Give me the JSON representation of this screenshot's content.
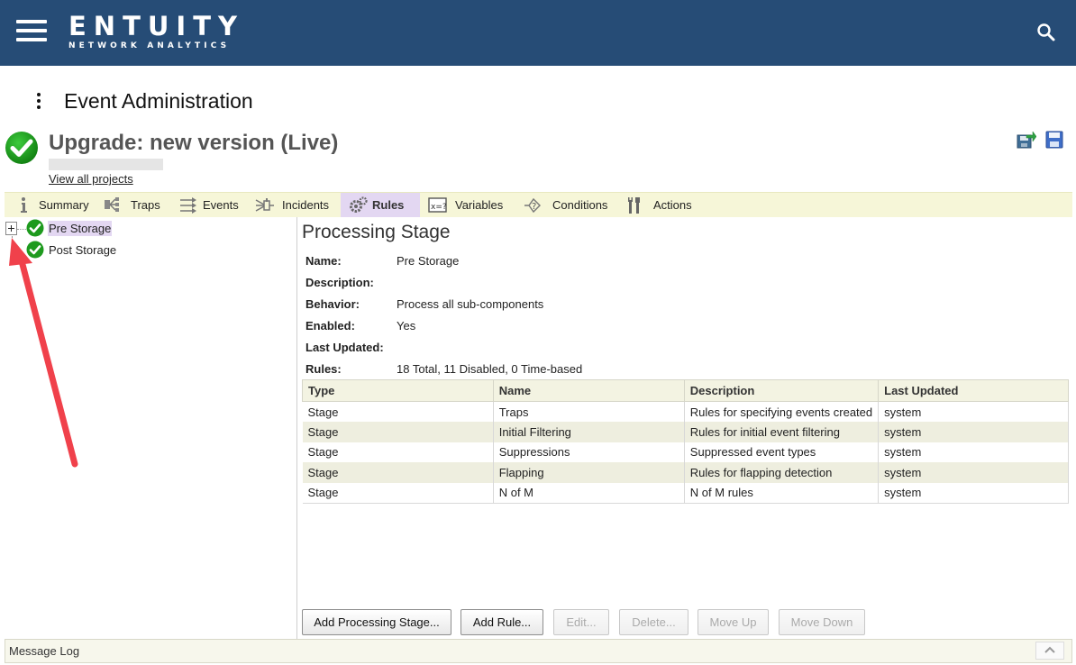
{
  "header": {
    "logo_main": "ENTUITY",
    "logo_sub": "NETWORK ANALYTICS",
    "menu_icon": "hamburger-menu-icon",
    "search_icon": "search-icon",
    "bg_color": "#264c76"
  },
  "page": {
    "title": "Event Administration",
    "kebab_icon": "more-vertical-icon"
  },
  "project": {
    "title": "Upgrade: new version (Live)",
    "status_icon": "check-circle-icon",
    "view_all_label": "View all projects",
    "export_icon": "export-icon",
    "save_icon": "save-icon"
  },
  "tabs": [
    {
      "label": "Summary",
      "icon": "info-icon",
      "active": false
    },
    {
      "label": "Traps",
      "icon": "traps-icon",
      "active": false
    },
    {
      "label": "Events",
      "icon": "events-icon",
      "active": false
    },
    {
      "label": "Incidents",
      "icon": "incidents-icon",
      "active": false
    },
    {
      "label": "Rules",
      "icon": "gears-icon",
      "active": true
    },
    {
      "label": "Variables",
      "icon": "variables-icon",
      "active": false
    },
    {
      "label": "Conditions",
      "icon": "conditions-icon",
      "active": false
    },
    {
      "label": "Actions",
      "icon": "wrench-icon",
      "active": false
    }
  ],
  "tree": {
    "nodes": [
      {
        "label": "Pre Storage",
        "selected": true,
        "expandable": true
      },
      {
        "label": "Post Storage",
        "selected": false,
        "expandable": false
      }
    ]
  },
  "detail": {
    "title": "Processing Stage",
    "properties": [
      {
        "key": "Name:",
        "value": "Pre Storage"
      },
      {
        "key": "Description:",
        "value": ""
      },
      {
        "key": "Behavior:",
        "value": "Process all sub-components"
      },
      {
        "key": "Enabled:",
        "value": "Yes"
      },
      {
        "key": "Last Updated:",
        "value": ""
      },
      {
        "key": "Rules:",
        "value": "18 Total, 11 Disabled, 0 Time-based"
      }
    ],
    "table": {
      "columns": [
        "Type",
        "Name",
        "Description",
        "Last Updated"
      ],
      "rows": [
        [
          "Stage",
          "Traps",
          "Rules for specifying events created",
          "system"
        ],
        [
          "Stage",
          "Initial Filtering",
          "Rules for initial event filtering",
          "system"
        ],
        [
          "Stage",
          "Suppressions",
          "Suppressed event types",
          "system"
        ],
        [
          "Stage",
          "Flapping",
          "Rules for flapping detection",
          "system"
        ],
        [
          "Stage",
          "N of M",
          "N of M rules",
          "system"
        ]
      ]
    }
  },
  "buttons": {
    "add_stage": "Add Processing Stage...",
    "add_rule": "Add Rule...",
    "edit": "Edit...",
    "delete": "Delete...",
    "move_up": "Move Up",
    "move_down": "Move Down"
  },
  "message_log": {
    "label": "Message Log",
    "toggle_icon": "chevron-up-icon"
  },
  "colors": {
    "accent_active_tab": "#e3d7f2",
    "status_ok": "#1a9a1a",
    "annotation_arrow": "#f0414b"
  }
}
